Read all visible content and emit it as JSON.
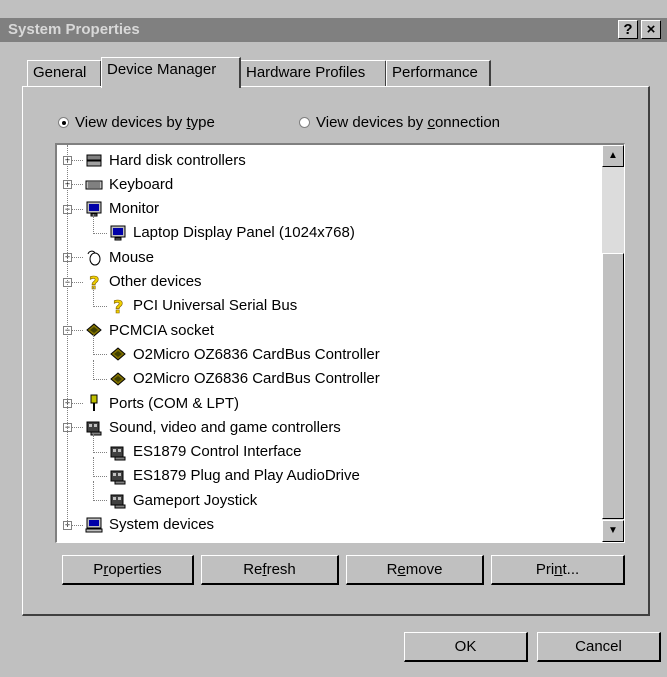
{
  "window": {
    "title": "System Properties",
    "help_btn": "?",
    "close_btn": "×"
  },
  "tabs": [
    {
      "label": "General",
      "active": false
    },
    {
      "label": "Device Manager",
      "active": true
    },
    {
      "label": "Hardware Profiles",
      "active": false
    },
    {
      "label": "Performance",
      "active": false
    }
  ],
  "view": {
    "by_type": {
      "pre": "View devices by ",
      "u": "t",
      "post": "ype",
      "selected": true
    },
    "by_connection": {
      "pre": "View devices by ",
      "u": "c",
      "post": "onnection",
      "selected": false
    }
  },
  "tree": [
    {
      "label": "Hard disk controllers",
      "level": 0,
      "expander": "+",
      "icon": "hard-disk-controller-icon"
    },
    {
      "label": "Keyboard",
      "level": 0,
      "expander": "+",
      "icon": "keyboard-icon"
    },
    {
      "label": "Monitor",
      "level": 0,
      "expander": "−",
      "icon": "monitor-icon"
    },
    {
      "label": "Laptop Display Panel (1024x768)",
      "level": 1,
      "icon": "monitor-icon"
    },
    {
      "label": "Mouse",
      "level": 0,
      "expander": "+",
      "icon": "mouse-icon"
    },
    {
      "label": "Other devices",
      "level": 0,
      "expander": "−",
      "icon": "question-mark-icon"
    },
    {
      "label": "PCI Universal Serial Bus",
      "level": 1,
      "icon": "question-mark-icon"
    },
    {
      "label": "PCMCIA socket",
      "level": 0,
      "expander": "−",
      "icon": "pcmcia-card-icon"
    },
    {
      "label": "O2Micro OZ6836 CardBus Controller",
      "level": 1,
      "icon": "pcmcia-card-icon"
    },
    {
      "label": "O2Micro OZ6836 CardBus Controller",
      "level": 1,
      "icon": "pcmcia-card-icon"
    },
    {
      "label": "Ports (COM & LPT)",
      "level": 0,
      "expander": "+",
      "icon": "port-connector-icon"
    },
    {
      "label": "Sound, video and game controllers",
      "level": 0,
      "expander": "−",
      "icon": "sound-card-icon"
    },
    {
      "label": "ES1879 Control Interface",
      "level": 1,
      "icon": "sound-card-icon"
    },
    {
      "label": "ES1879 Plug and Play AudioDrive",
      "level": 1,
      "icon": "sound-card-icon"
    },
    {
      "label": "Gameport Joystick",
      "level": 1,
      "icon": "sound-card-icon"
    },
    {
      "label": "System devices",
      "level": 0,
      "expander": "+",
      "icon": "computer-icon"
    }
  ],
  "buttons": {
    "properties": {
      "pre": "P",
      "u": "r",
      "post": "operties"
    },
    "refresh": {
      "pre": "Re",
      "u": "f",
      "post": "resh"
    },
    "remove": {
      "pre": "R",
      "u": "e",
      "post": "move"
    },
    "print": {
      "pre": "Pri",
      "u": "n",
      "post": "t..."
    },
    "ok": "OK",
    "cancel": "Cancel"
  },
  "colors": {
    "titlebar": "#808080",
    "face": "#c0c0c0"
  }
}
